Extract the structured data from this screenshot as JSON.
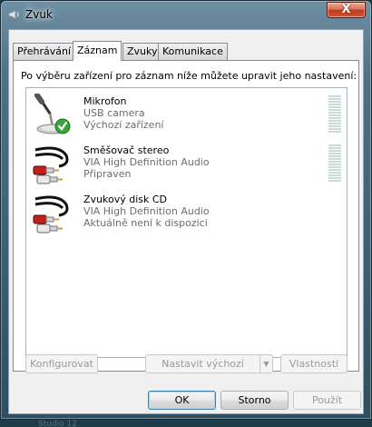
{
  "window": {
    "title": "Zvuk",
    "close_symbol": "X"
  },
  "tabs": [
    {
      "label": "Přehrávání",
      "active": false
    },
    {
      "label": "Záznam",
      "active": true
    },
    {
      "label": "Zvuky",
      "active": false
    },
    {
      "label": "Komunikace",
      "active": false
    }
  ],
  "panel": {
    "instruction": "Po výběru zařízení pro záznam níže můžete upravit jeho nastavení:"
  },
  "devices": [
    {
      "name": "Mikrofon",
      "line1": "USB camera",
      "line2": "Výchozí zařízení",
      "icon": "microphone-icon",
      "default": true
    },
    {
      "name": "Směšovač stereo",
      "line1": "VIA High Definition Audio",
      "line2": "Připraven",
      "icon": "rca-cable-icon",
      "default": false
    },
    {
      "name": "Zvukový disk CD",
      "line1": "VIA High Definition Audio",
      "line2": "Aktuálně není k dispozici",
      "icon": "rca-cable-icon",
      "default": false
    }
  ],
  "panel_buttons": {
    "configure": "Konfigurovat",
    "set_default": "Nastavit výchozí",
    "properties": "Vlastnosti"
  },
  "dialog_buttons": {
    "ok": "OK",
    "cancel": "Storno",
    "apply": "Použít"
  },
  "taskbar": {
    "partial_text": "Studio 12"
  },
  "colors": {
    "check_green": "#3aa53a",
    "plug_red": "#c0201a",
    "disabled_text": "#9a9a9a"
  }
}
